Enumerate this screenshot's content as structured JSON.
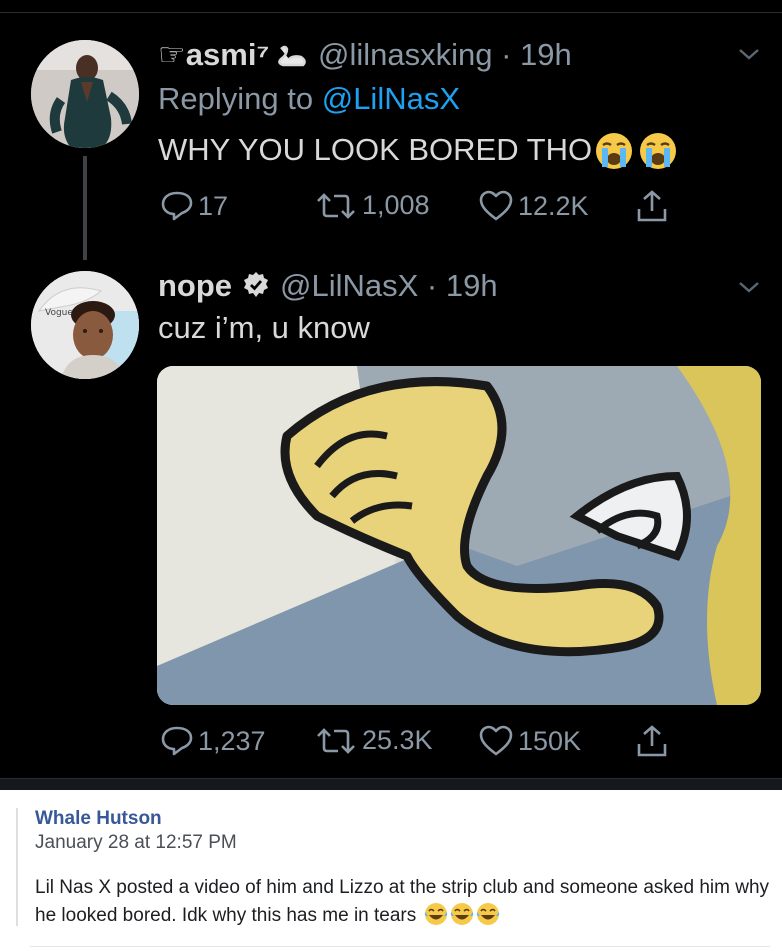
{
  "tweet1": {
    "display_name": "☞asmi⁷",
    "handle_time": "@lilnasxking · 19h",
    "replying_prefix": "Replying to ",
    "replying_mention": "@LilNasX",
    "text": "WHY YOU LOOK BORED THO",
    "text_emojis": [
      "loudly-crying-face-icon",
      "loudly-crying-face-icon"
    ],
    "actions": {
      "replies": "17",
      "retweets": "1,008",
      "likes": "12.2K"
    }
  },
  "tweet2": {
    "display_name": "nope",
    "verified": true,
    "handle_time": "@LilNasX · 19h",
    "text": "cuz i’m, u know",
    "actions": {
      "replies": "1,237",
      "retweets": "25.3K",
      "likes": "150K"
    }
  },
  "facebook_comment": {
    "author": "Whale Hutson",
    "date": "January 28 at 12:57 PM",
    "text": "Lil Nas X posted a video of him and Lizzo at the strip club and someone asked him why he looked bored. Idk why this has me in tears",
    "text_emojis": [
      "face-with-tears-of-joy-icon",
      "face-with-tears-of-joy-icon",
      "face-with-tears-of-joy-icon"
    ]
  },
  "colors": {
    "background": "#000000",
    "text": "#d9d9d9",
    "muted": "#8b98a5",
    "link": "#1da1f2",
    "fb_name": "#385898"
  }
}
